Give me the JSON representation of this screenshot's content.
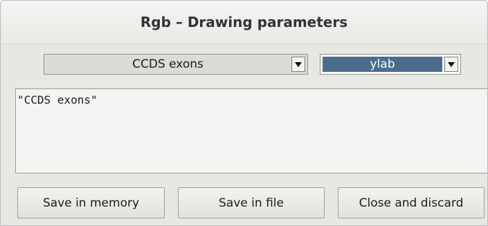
{
  "window": {
    "title": "Rgb – Drawing parameters"
  },
  "track_select": {
    "selected": "CCDS exons",
    "icon": "chevron-down-icon"
  },
  "parameter_select": {
    "selected": "ylab",
    "icon": "chevron-down-icon",
    "highlight_color": "#4a6d8c"
  },
  "editor": {
    "value": "\"CCDS exons\""
  },
  "buttons": {
    "save_memory": "Save in memory",
    "save_file": "Save in file",
    "close_discard": "Close and discard"
  }
}
